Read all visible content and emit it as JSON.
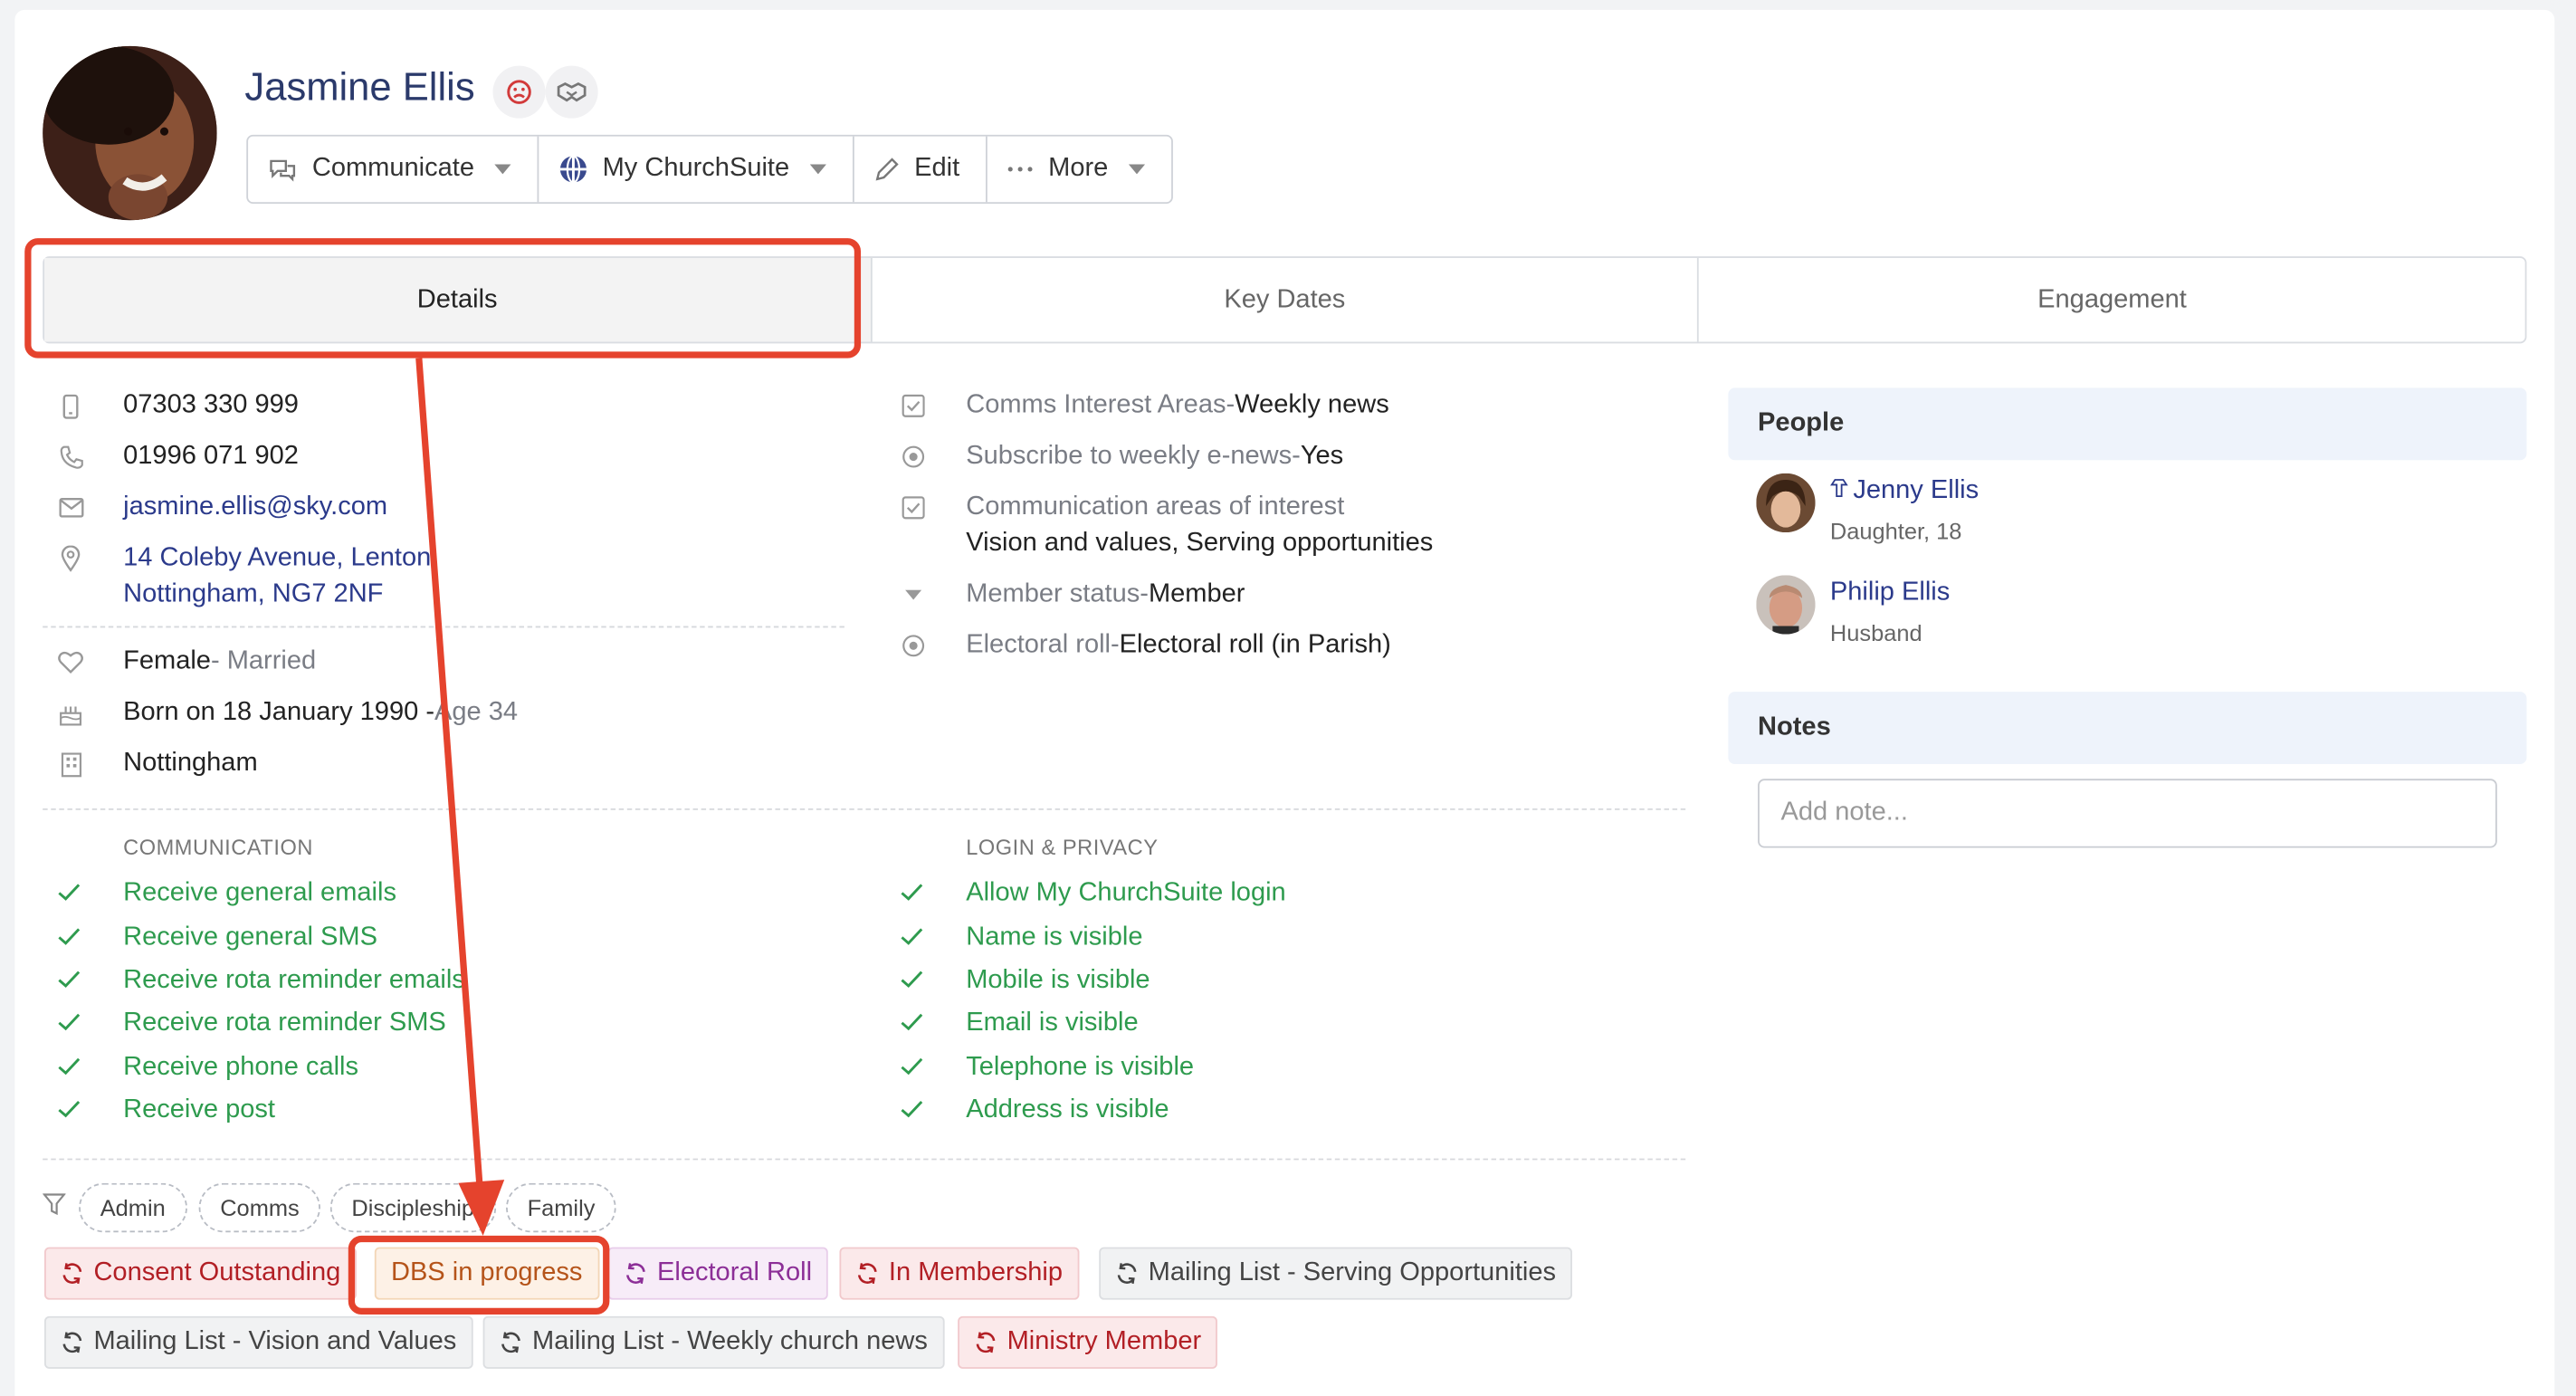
{
  "profile": {
    "name": "Jasmine Ellis",
    "actions": [
      {
        "label": "Communicate",
        "icon": "chat-icon",
        "dropdown": true
      },
      {
        "label": "My ChurchSuite",
        "icon": "globe-icon",
        "dropdown": true
      },
      {
        "label": "Edit",
        "icon": "pencil-icon",
        "dropdown": false
      },
      {
        "label": "More",
        "icon": "ellipsis-icon",
        "dropdown": true
      }
    ]
  },
  "tabs": [
    "Details",
    "Key Dates",
    "Engagement"
  ],
  "contact": {
    "mobile": "07303 330 999",
    "phone": "01996 071 902",
    "email": "jasmine.ellis@sky.com",
    "address_line1": "14 Coleby Avenue, Lenton",
    "address_line2": "Nottingham, NG7 2NF",
    "sex": "Female",
    "marital": " - Married",
    "born": "Born on 18 January 1990 -",
    "age": " Age 34",
    "site": "Nottingham"
  },
  "fields": [
    {
      "label": "Comms Interest Areas",
      "sep": " - ",
      "value": "Weekly news"
    },
    {
      "label": "Subscribe to weekly e-news",
      "sep": " - ",
      "value": "Yes"
    },
    {
      "label": "Communication areas of interest",
      "value2": "Vision and values, Serving opportunities"
    },
    {
      "label": "Member status",
      "sep": " - ",
      "value": "Member"
    },
    {
      "label": "Electoral roll",
      "sep": " - ",
      "value": "Electoral roll (in Parish)"
    }
  ],
  "communication": {
    "heading": "COMMUNICATION",
    "items": [
      "Receive general emails",
      "Receive general SMS",
      "Receive rota reminder emails",
      "Receive rota reminder SMS",
      "Receive phone calls",
      "Receive post"
    ]
  },
  "privacy": {
    "heading": "LOGIN & PRIVACY",
    "items": [
      "Allow My ChurchSuite login",
      "Name is visible",
      "Mobile is visible",
      "Email is visible",
      "Telephone is visible",
      "Address is visible"
    ]
  },
  "tag_filters": [
    "Admin",
    "Comms",
    "Discipleship",
    "Family"
  ],
  "tags": [
    {
      "label": "Consent Outstanding",
      "style": "red"
    },
    {
      "label": "DBS in progress",
      "style": "orange"
    },
    {
      "label": "Electoral Roll",
      "style": "purple"
    },
    {
      "label": "In Membership",
      "style": "red"
    },
    {
      "label": "Mailing List - Serving Opportunities",
      "style": "grey"
    },
    {
      "label": "Mailing List - Vision and Values",
      "style": "grey"
    },
    {
      "label": "Mailing List - Weekly church news",
      "style": "grey"
    },
    {
      "label": "Ministry Member",
      "style": "red"
    }
  ],
  "people": {
    "heading": "People",
    "items": [
      {
        "name": "Jenny Ellis",
        "relation": "Daughter, 18"
      },
      {
        "name": "Philip Ellis",
        "relation": "Husband"
      }
    ]
  },
  "notes": {
    "heading": "Notes",
    "placeholder": "Add note..."
  },
  "colors": {
    "accent": "#2b3a8b",
    "success": "#2e9b4e",
    "annotation": "#e5432d"
  }
}
